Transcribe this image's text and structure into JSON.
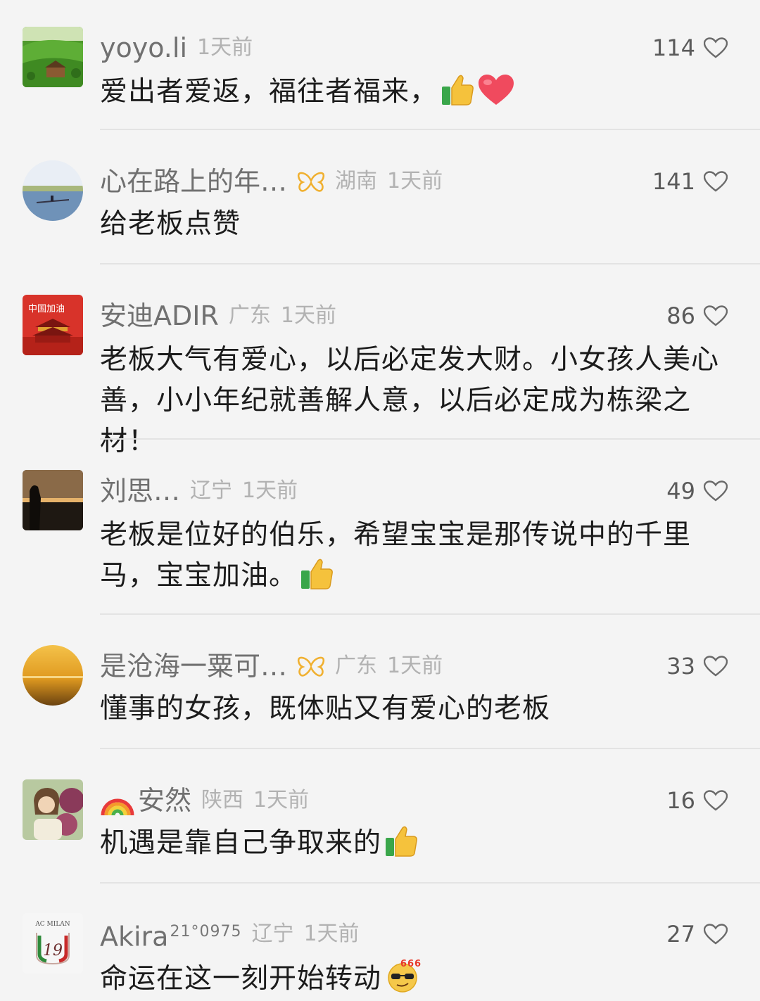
{
  "comments": [
    {
      "username": "yoyo.li",
      "location": "",
      "time": "1天前",
      "likes": "114",
      "text": "爱出者爱返，福往者福来，"
    },
    {
      "username": "心在路上的年…",
      "location": "湖南",
      "time": "1天前",
      "likes": "141",
      "text": "给老板点赞"
    },
    {
      "username": "安迪ADIR",
      "location": "广东",
      "time": "1天前",
      "likes": "86",
      "text": "老板大气有爱心，以后必定发大财。小女孩人美心善，小小年纪就善解人意，以后必定成为栋梁之材！"
    },
    {
      "username": "刘思…",
      "location": "辽宁",
      "time": "1天前",
      "likes": "49",
      "text": "老板是位好的伯乐，希望宝宝是那传说中的千里马，宝宝加油。"
    },
    {
      "username": "是沧海一粟可…",
      "location": "广东",
      "time": "1天前",
      "likes": "33",
      "text": "懂事的女孩，既体贴又有爱心的老板"
    },
    {
      "username": "安然",
      "location": "陕西",
      "time": "1天前",
      "likes": "16",
      "text": "机遇是靠自己争取来的"
    },
    {
      "username": "Akira",
      "username_sup": "21°0975",
      "location": "辽宁",
      "time": "1天前",
      "likes": "27",
      "text": "命运在这一刻开始转动"
    }
  ],
  "icons": {
    "like": "heart-outline-icon",
    "badge": "butterfly-badge-icon",
    "thumbs": "thumbs-up-emoji",
    "heart": "red-heart-emoji",
    "rainbow": "rainbow-emoji",
    "sunglasses": "666-sunglasses-emoji"
  },
  "avatar_badge_text": {
    "avatar_3": "中国加油",
    "avatar_7": "AC MILAN"
  },
  "colors": {
    "background": "#f4f4f4",
    "text": "#1c1c1c",
    "meta": "#b2b2b2",
    "username": "#707070",
    "badge": "#f0b030",
    "heart_emoji": "#f04a5e"
  }
}
